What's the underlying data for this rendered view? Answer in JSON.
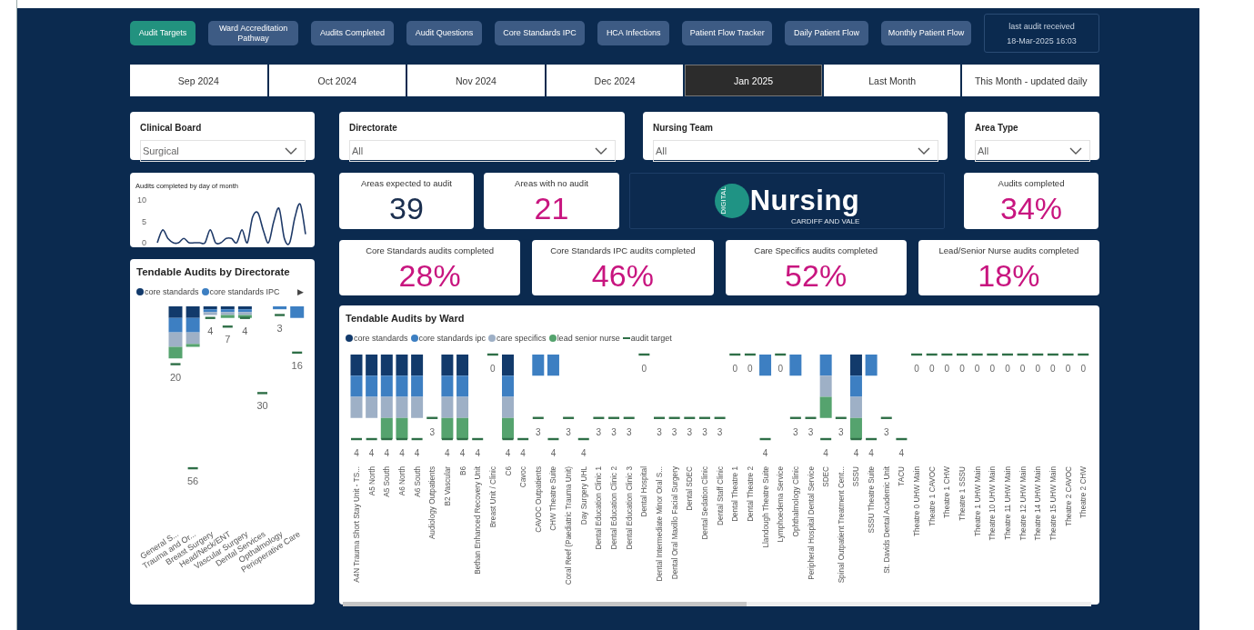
{
  "nav_buttons": [
    {
      "label": "Audit Targets",
      "selected": true
    },
    {
      "label": "Ward Accreditation Pathway",
      "selected": false
    },
    {
      "label": "Audits Completed",
      "selected": false
    },
    {
      "label": "Audit Questions",
      "selected": false
    },
    {
      "label": "Core Standards IPC",
      "selected": false
    },
    {
      "label": "HCA Infections",
      "selected": false
    },
    {
      "label": "Patient Flow Tracker",
      "selected": false
    },
    {
      "label": "Daily Patient Flow",
      "selected": false
    },
    {
      "label": "Monthly Patient Flow",
      "selected": false
    }
  ],
  "last_audit": {
    "label": "last audit received",
    "value": "18-Mar-2025 16:03"
  },
  "month_tabs": [
    {
      "label": "Sep 2024",
      "selected": false
    },
    {
      "label": "Oct 2024",
      "selected": false
    },
    {
      "label": "Nov 2024",
      "selected": false
    },
    {
      "label": "Dec 2024",
      "selected": false
    },
    {
      "label": "Jan 2025",
      "selected": true
    },
    {
      "label": "Last Month",
      "selected": false
    },
    {
      "label": "This Month - updated daily",
      "selected": false
    }
  ],
  "filters": [
    {
      "label": "Clinical Board",
      "value": "Surgical"
    },
    {
      "label": "Directorate",
      "value": "All"
    },
    {
      "label": "Nursing Team",
      "value": "All"
    },
    {
      "label": "Area Type",
      "value": "All"
    }
  ],
  "daily_chart": {
    "chart_data": {
      "type": "line",
      "title": "Audits completed by day of month",
      "ylim": [
        0,
        10
      ],
      "yticks": [
        0,
        5,
        10
      ],
      "series": [
        {
          "color": "#1f3a68",
          "values": [
            0,
            3,
            1,
            0,
            0,
            1,
            0,
            0,
            0,
            0,
            3,
            0,
            0,
            1,
            1,
            0,
            3,
            0,
            6,
            7,
            3,
            0,
            5,
            8,
            1,
            0,
            6,
            9,
            2
          ]
        }
      ]
    }
  },
  "kpis": [
    {
      "title": "Areas expected to audit",
      "value": "39",
      "color": "#1b2f4f"
    },
    {
      "title": "Areas with no audit",
      "value": "21",
      "color": "#c8157f"
    },
    {
      "title": "Audits completed",
      "value": "34%",
      "color": "#c8157f"
    }
  ],
  "logo": {
    "badge": "DIGITAL",
    "word": "Nursing",
    "subtitle": "CARDIFF AND VALE"
  },
  "completion_cards": [
    {
      "title": "Core Standards audits completed",
      "value": "28%",
      "color": "#c8157f"
    },
    {
      "title": "Core Standards IPC audits completed",
      "value": "46%",
      "color": "#c8157f"
    },
    {
      "title": "Care Specifics audits completed",
      "value": "52%",
      "color": "#c8157f"
    },
    {
      "title": "Lead/Senior Nurse audits completed",
      "value": "18%",
      "color": "#c8157f"
    }
  ],
  "directorate_chart": {
    "title": "Tendable Audits by Directorate",
    "legend_more": "▶",
    "legend": [
      {
        "name": "core standards",
        "color": "#123a6b"
      },
      {
        "name": "core standards IPC",
        "color": "#3d7fc2"
      }
    ],
    "directorates": [
      {
        "name": "General S...",
        "target": "20"
      },
      {
        "name": "Trauma and Or...",
        "target": "56"
      },
      {
        "name": "Breast Surgery",
        "target": "4"
      },
      {
        "name": "Head/Neck/ENT",
        "target": "7"
      },
      {
        "name": "Vascular Surgery",
        "target": "4"
      },
      {
        "name": "Dental Services",
        "target": "30"
      },
      {
        "name": "Opthalmology",
        "target": "3"
      },
      {
        "name": "Perioperative Care",
        "target": "16"
      }
    ]
  },
  "ward_chart": {
    "title": "Tendable Audits by Ward",
    "target_legend": "audit target",
    "legend": [
      {
        "name": "core standards",
        "color": "#123a6b"
      },
      {
        "name": "core standards ipc",
        "color": "#3d7fc2"
      },
      {
        "name": "care specifics",
        "color": "#9eb0c6"
      },
      {
        "name": "lead senior nurse",
        "color": "#55a36e"
      }
    ],
    "wards": [
      {
        "name": "A4N Trauma Short Stay Unit - TS...",
        "target": "4",
        "audits": [
          true,
          true,
          true,
          false
        ]
      },
      {
        "name": "A5 North",
        "target": "4",
        "audits": [
          true,
          true,
          true,
          false
        ]
      },
      {
        "name": "A5 South",
        "target": "4",
        "audits": [
          true,
          true,
          true,
          true
        ]
      },
      {
        "name": "A6 North",
        "target": "4",
        "audits": [
          true,
          true,
          true,
          true
        ]
      },
      {
        "name": "A6 South",
        "target": "4",
        "audits": [
          true,
          true,
          true,
          false
        ]
      },
      {
        "name": "Audiology Outpatients",
        "target": "3",
        "audits": [
          false,
          false,
          false,
          false
        ]
      },
      {
        "name": "B2 Vascular",
        "target": "4",
        "audits": [
          true,
          true,
          true,
          true
        ]
      },
      {
        "name": "B6",
        "target": "4",
        "audits": [
          true,
          true,
          true,
          true
        ]
      },
      {
        "name": "Bethan Enhanced Recovery Unit",
        "target": "4",
        "audits": [
          false,
          false,
          false,
          false
        ]
      },
      {
        "name": "Breast Unit / Clinic",
        "target": "0",
        "audits": [
          false,
          false,
          false,
          false
        ]
      },
      {
        "name": "C6",
        "target": "4",
        "audits": [
          true,
          true,
          true,
          true
        ]
      },
      {
        "name": "Cavoc",
        "target": "4",
        "audits": [
          false,
          false,
          false,
          false
        ]
      },
      {
        "name": "CAVOC Outpatients",
        "target": "3",
        "audits": [
          false,
          true,
          false,
          false
        ]
      },
      {
        "name": "CHW Theatre Suite",
        "target": "4",
        "audits": [
          false,
          true,
          false,
          false
        ]
      },
      {
        "name": "Coral Reef (Paediatric Trauma Unit)",
        "target": "3",
        "audits": [
          false,
          false,
          false,
          false
        ]
      },
      {
        "name": "Day Surgery UHL",
        "target": "4",
        "audits": [
          false,
          false,
          false,
          false
        ]
      },
      {
        "name": "Dental Education Clinic 1",
        "target": "3",
        "audits": [
          false,
          false,
          false,
          false
        ]
      },
      {
        "name": "Dental Education Clinic 2",
        "target": "3",
        "audits": [
          false,
          false,
          false,
          false
        ]
      },
      {
        "name": "Dental Education Clinic 3",
        "target": "3",
        "audits": [
          false,
          false,
          false,
          false
        ]
      },
      {
        "name": "Dental Hospital",
        "target": "0",
        "audits": [
          false,
          false,
          false,
          false
        ]
      },
      {
        "name": "Dental Intermediate Minor Oral S...",
        "target": "3",
        "audits": [
          false,
          false,
          false,
          false
        ]
      },
      {
        "name": "Dental Oral Maxillo Facial Surgery",
        "target": "3",
        "audits": [
          false,
          false,
          false,
          false
        ]
      },
      {
        "name": "Dental SDEC",
        "target": "3",
        "audits": [
          false,
          false,
          false,
          false
        ]
      },
      {
        "name": "Dental Sedation Clinic",
        "target": "3",
        "audits": [
          false,
          false,
          false,
          false
        ]
      },
      {
        "name": "Dental Staff Clinic",
        "target": "3",
        "audits": [
          false,
          false,
          false,
          false
        ]
      },
      {
        "name": "Dental Theatre 1",
        "target": "0",
        "audits": [
          false,
          false,
          false,
          false
        ]
      },
      {
        "name": "Dental Theatre 2",
        "target": "0",
        "audits": [
          false,
          false,
          false,
          false
        ]
      },
      {
        "name": "Llandough Theatre Suite",
        "target": "4",
        "audits": [
          false,
          true,
          false,
          false
        ]
      },
      {
        "name": "Lymphoedema Service",
        "target": "0",
        "audits": [
          false,
          false,
          false,
          false
        ]
      },
      {
        "name": "Ophthalmology Clinic",
        "target": "3",
        "audits": [
          false,
          true,
          false,
          false
        ]
      },
      {
        "name": "Peripheral Hospital Dental Service",
        "target": "3",
        "audits": [
          false,
          false,
          false,
          false
        ]
      },
      {
        "name": "SDEC",
        "target": "4",
        "audits": [
          false,
          true,
          true,
          true
        ]
      },
      {
        "name": "Spinal Outpatient Treatment Cent...",
        "target": "3",
        "audits": [
          false,
          false,
          false,
          false
        ]
      },
      {
        "name": "SSSU",
        "target": "4",
        "audits": [
          true,
          true,
          true,
          true
        ]
      },
      {
        "name": "SSSU Theatre Suite",
        "target": "4",
        "audits": [
          false,
          true,
          false,
          false
        ]
      },
      {
        "name": "St. Davids Dental Academic Unit",
        "target": "3",
        "audits": [
          false,
          false,
          false,
          false
        ]
      },
      {
        "name": "TACU",
        "target": "4",
        "audits": [
          false,
          false,
          false,
          false
        ]
      },
      {
        "name": "Theatre 0 UHW Main",
        "target": "0",
        "audits": [
          false,
          false,
          false,
          false
        ]
      },
      {
        "name": "Theatre 1 CAVOC",
        "target": "0",
        "audits": [
          false,
          false,
          false,
          false
        ]
      },
      {
        "name": "Theatre 1 CHW",
        "target": "0",
        "audits": [
          false,
          false,
          false,
          false
        ]
      },
      {
        "name": "Theatre 1 SSSU",
        "target": "0",
        "audits": [
          false,
          false,
          false,
          false
        ]
      },
      {
        "name": "Theatre 1 UHW Main",
        "target": "0",
        "audits": [
          false,
          false,
          false,
          false
        ]
      },
      {
        "name": "Theatre 10 UHW Main",
        "target": "0",
        "audits": [
          false,
          false,
          false,
          false
        ]
      },
      {
        "name": "Theatre 11 UHW Main",
        "target": "0",
        "audits": [
          false,
          false,
          false,
          false
        ]
      },
      {
        "name": "Theatre 12 UHW Main",
        "target": "0",
        "audits": [
          false,
          false,
          false,
          false
        ]
      },
      {
        "name": "Theatre 14 UHW Main",
        "target": "0",
        "audits": [
          false,
          false,
          false,
          false
        ]
      },
      {
        "name": "Theatre 15 UHW Main",
        "target": "0",
        "audits": [
          false,
          false,
          false,
          false
        ]
      },
      {
        "name": "Theatre 2 CAVOC",
        "target": "0",
        "audits": [
          false,
          false,
          false,
          false
        ]
      },
      {
        "name": "Theatre 2 CHW",
        "target": "0",
        "audits": [
          false,
          false,
          false,
          false
        ]
      }
    ]
  }
}
